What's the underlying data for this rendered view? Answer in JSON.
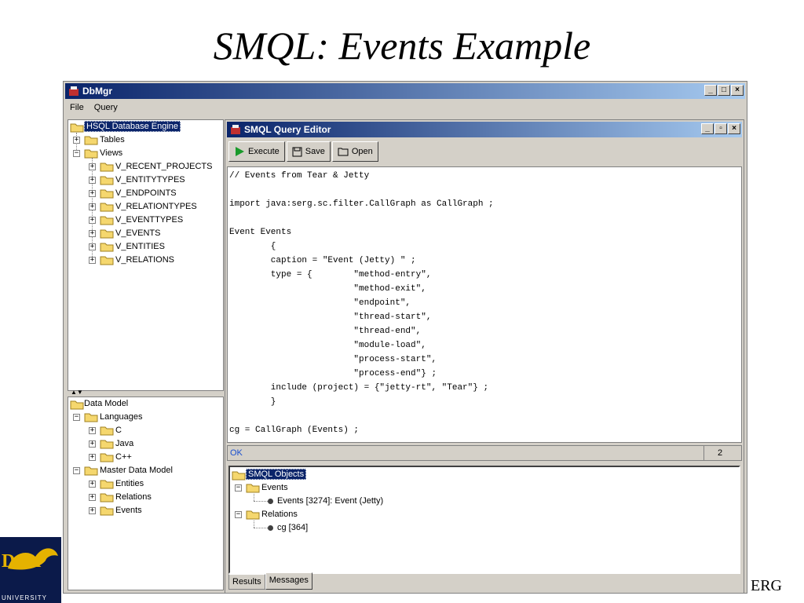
{
  "slide": {
    "title": "SMQL: Events Example",
    "footer_right": "ERG"
  },
  "logo": {
    "name": "Drex",
    "sub": "UNIVERSITY"
  },
  "app": {
    "title": "DbMgr",
    "menu": [
      "File",
      "Query"
    ],
    "window_buttons": [
      "_",
      "□",
      "×"
    ]
  },
  "left_top_tree": {
    "root": "HSQL Database Engine",
    "items": [
      {
        "label": "Tables"
      },
      {
        "label": "Views"
      },
      {
        "label": "V_RECENT_PROJECTS"
      },
      {
        "label": "V_ENTITYTYPES"
      },
      {
        "label": "V_ENDPOINTS"
      },
      {
        "label": "V_RELATIONTYPES"
      },
      {
        "label": "V_EVENTTYPES"
      },
      {
        "label": "V_EVENTS"
      },
      {
        "label": "V_ENTITIES"
      },
      {
        "label": "V_RELATIONS"
      }
    ]
  },
  "left_bottom_tree": {
    "root": "Data Model",
    "items": [
      {
        "label": "Languages"
      },
      {
        "label": "C"
      },
      {
        "label": "Java"
      },
      {
        "label": "C++"
      },
      {
        "label": "Master Data Model"
      },
      {
        "label": "Entities"
      },
      {
        "label": "Relations"
      },
      {
        "label": "Events"
      }
    ]
  },
  "editor": {
    "title": "SMQL Query Editor",
    "window_buttons": [
      "_",
      "▫",
      "×"
    ],
    "toolbar": {
      "execute": "Execute",
      "save": "Save",
      "open": "Open"
    },
    "code": [
      "// Events from Tear & Jetty",
      "",
      "import java:serg.sc.filter.CallGraph as CallGraph ;",
      "",
      "Event Events",
      "        {",
      "        caption = \"Event (Jetty) \" ;",
      "        type = {        \"method-entry\",",
      "                        \"method-exit\",",
      "                        \"endpoint\",",
      "                        \"thread-start\",",
      "                        \"thread-end\",",
      "                        \"module-load\",",
      "                        \"process-start\",",
      "                        \"process-end\"} ;",
      "        include (project) = {\"jetty-rt\", \"Tear\"} ;",
      "        }",
      "",
      "cg = CallGraph (Events) ;"
    ],
    "status": {
      "text": "OK",
      "count": "2"
    },
    "results_tree": {
      "root": "SMQL Objects",
      "events_group": "Events",
      "events_item": "Events [3274]: Event (Jetty)",
      "relations_group": "Relations",
      "relations_item": "cg [364]"
    },
    "tabs": {
      "results": "Results",
      "messages": "Messages"
    }
  }
}
